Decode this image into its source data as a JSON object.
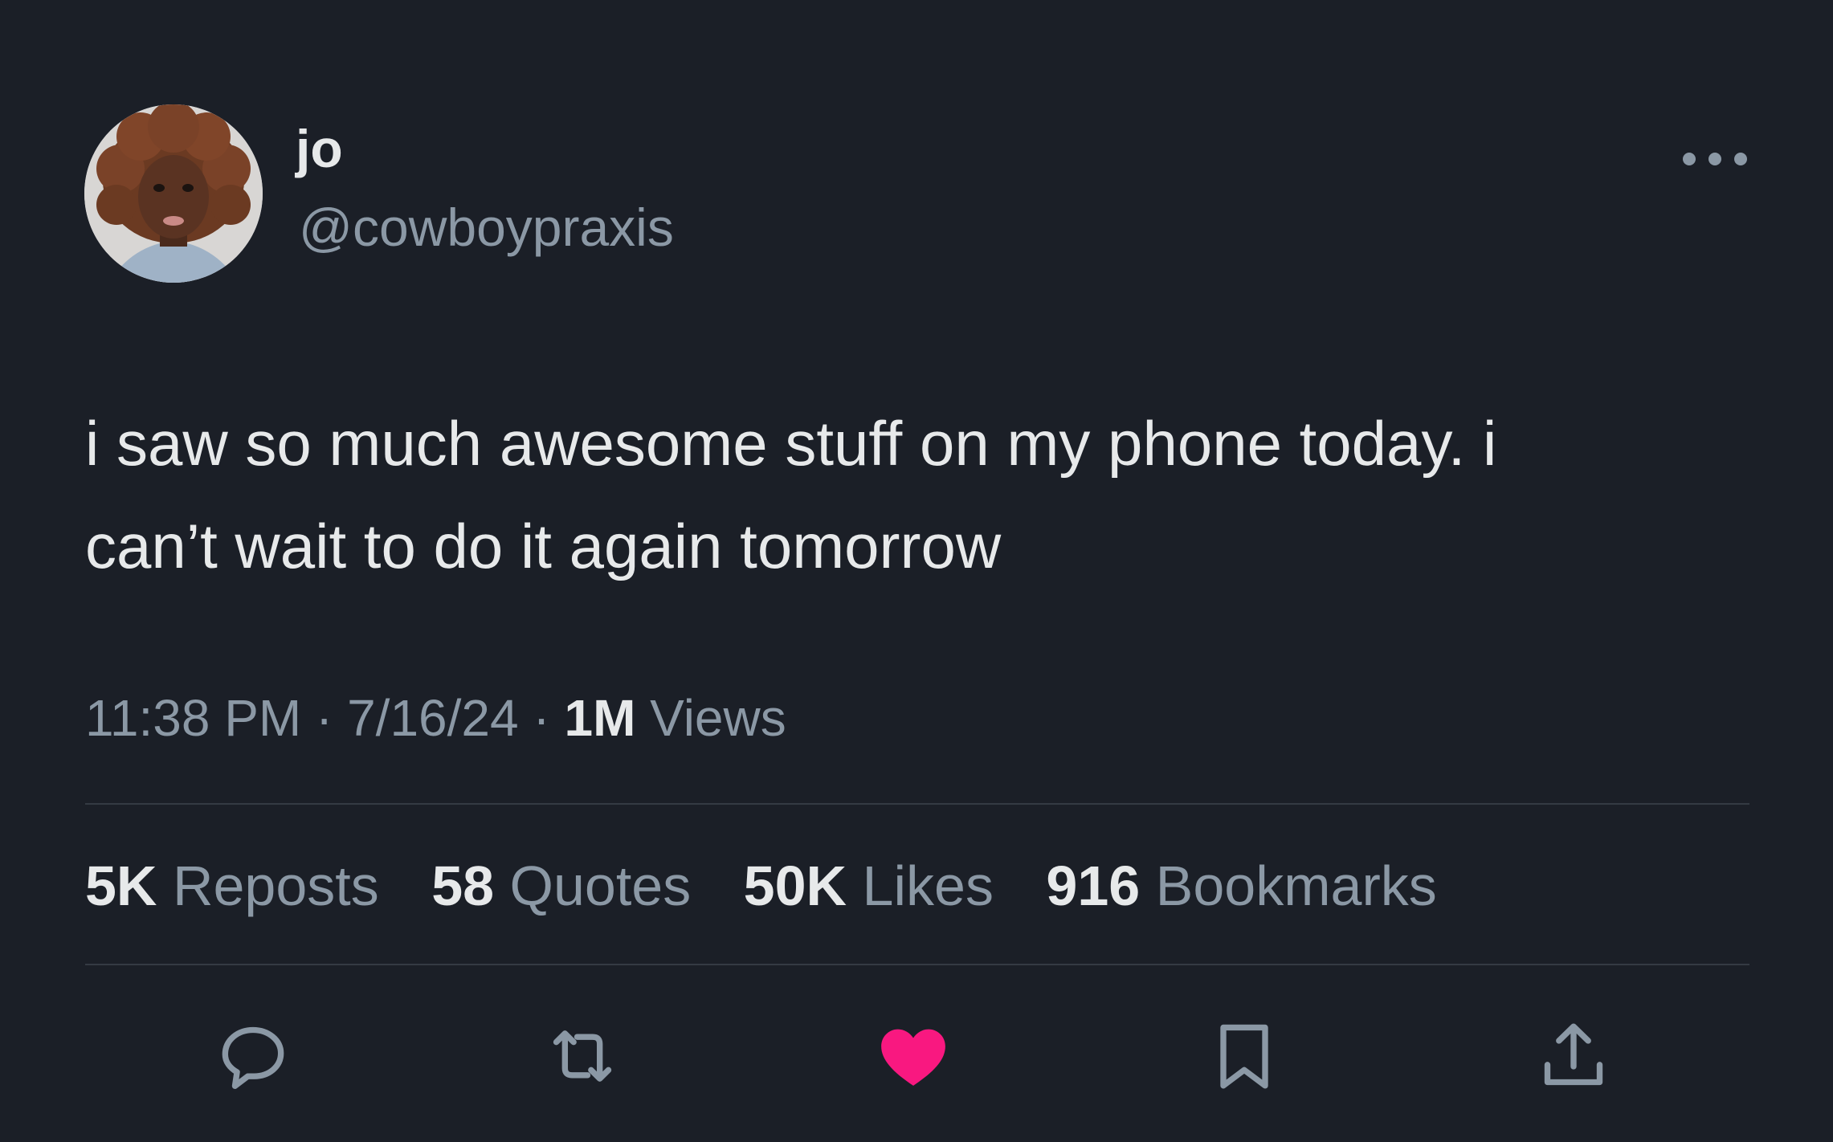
{
  "author": {
    "display_name": "jo",
    "handle": "@cowboypraxis"
  },
  "tweet": {
    "text": "i saw so much awesome stuff on my phone today. i\ncan’t wait to do it again tomorrow",
    "time": "11:38 PM",
    "date": "7/16/24",
    "separator": "·",
    "views_count": "1M",
    "views_label": "Views"
  },
  "stats": {
    "reposts": {
      "count": "5K",
      "label": "Reposts"
    },
    "quotes": {
      "count": "58",
      "label": "Quotes"
    },
    "likes": {
      "count": "50K",
      "label": "Likes"
    },
    "bookmarks": {
      "count": "916",
      "label": "Bookmarks"
    }
  },
  "actions": {
    "reply_icon": "speech-bubble-icon",
    "retweet_icon": "retweet-arrows-icon",
    "like_icon": "heart-icon",
    "like_state": "liked",
    "bookmark_icon": "bookmark-icon",
    "share_icon": "share-upload-icon"
  },
  "colors": {
    "background": "#1b1f27",
    "primary_text": "#e7e9ea",
    "secondary_text": "#8b98a5",
    "like_active": "#f91880"
  }
}
